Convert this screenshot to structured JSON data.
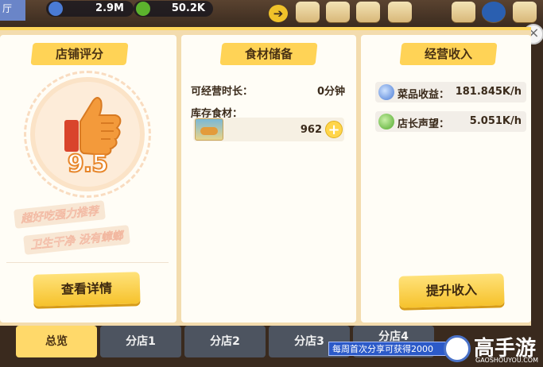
{
  "hud": {
    "shop_name": "厅",
    "resource_1": "2.9M",
    "resource_2": "50.2K"
  },
  "close_label": "×",
  "rating_column": {
    "title": "店铺评分",
    "score": "9.5",
    "slogan_1": "超好吃强力推荐",
    "slogan_2": "卫生干净 没有蟑螂",
    "details_button": "查看详情"
  },
  "ingredients_column": {
    "title": "食材储备",
    "duration_label": "可经营时长：",
    "duration_value": "0分钟",
    "stock_label": "库存食材：",
    "stock_count": "962",
    "add_label": "+"
  },
  "income_column": {
    "title": "经营收入",
    "rows": [
      {
        "label": "菜品收益：",
        "value": "181.845K/h",
        "icon": "coin-icon"
      },
      {
        "label": "店长声望：",
        "value": "5.051K/h",
        "icon": "thumb-badge-icon"
      }
    ],
    "upgrade_button": "提升收入"
  },
  "tabs": [
    "总览",
    "分店1",
    "分店2",
    "分店3",
    "分店4"
  ],
  "active_tab": 0,
  "share_banner": "每周首次分享可获得2000",
  "watermark": {
    "name": "高手游",
    "domain": "GAOSHOUYOU.COM"
  },
  "colors": {
    "accent": "#ffd356",
    "panel": "#f3dcae",
    "score_stroke": "#e7862a"
  }
}
